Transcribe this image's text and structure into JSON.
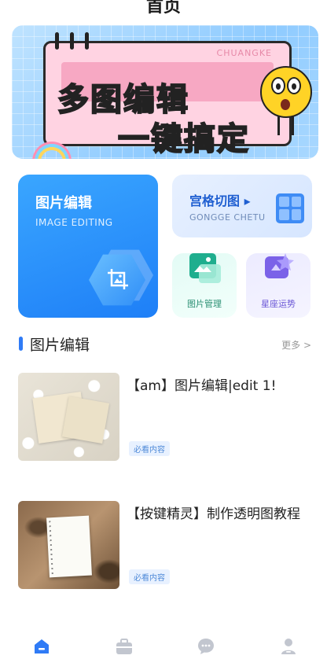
{
  "header": {
    "title": "首页"
  },
  "banner": {
    "tag": "CHUANGKE",
    "line1": "多图编辑",
    "line2": "一键搞定"
  },
  "features": {
    "image_edit": {
      "title": "图片编辑",
      "subtitle": "IMAGE EDITING"
    },
    "grid_cut": {
      "title": "宫格切图 ▸",
      "subtitle": "GONGGE CHETU"
    },
    "photo_manage": {
      "label": "图片管理"
    },
    "horoscope": {
      "label": "星座运势"
    }
  },
  "section": {
    "title": "图片编辑",
    "more": "更多 >"
  },
  "items": [
    {
      "title": "【am】图片编辑|edit 1!",
      "tag": "必看内容"
    },
    {
      "title": "【按键精灵】制作透明图教程",
      "tag": "必看内容"
    }
  ],
  "nav": {
    "items": [
      "home-icon",
      "briefcase-icon",
      "message-icon",
      "profile-icon"
    ],
    "active_color": "#2f7bf6",
    "inactive_color": "#c2c6cf"
  }
}
